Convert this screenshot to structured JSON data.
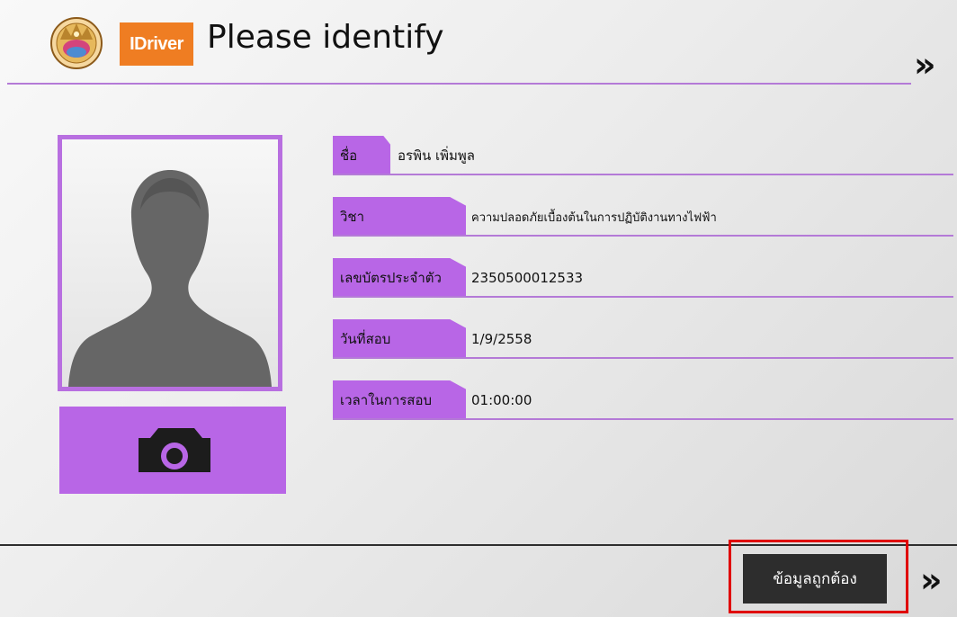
{
  "header": {
    "brand_logo_text": "IDriver",
    "title": "Please identify",
    "seal_icon": "government-seal-logo",
    "next_icon": "double-chevron-right-icon"
  },
  "profile": {
    "photo_icon": "person-silhouette-icon",
    "camera_icon": "camera-icon"
  },
  "fields": [
    {
      "label": "ชื่อ",
      "value": "อรพิน  เพิ่มพูล"
    },
    {
      "label": "วิชา",
      "value": "ความปลอดภัยเบื้องต้นในการปฏิบัติงานทางไฟฟ้า"
    },
    {
      "label": "เลขบัตรประจำตัว",
      "value": "2350500012533"
    },
    {
      "label": "วันที่สอบ",
      "value": "1/9/2558"
    },
    {
      "label": "เวลาในการสอบ",
      "value": "01:00:00"
    }
  ],
  "footer": {
    "confirm_label": "ข้อมูลถูกต้อง",
    "next_icon": "double-chevron-right-icon"
  },
  "colors": {
    "accent_purple": "#b866e6",
    "line_purple": "#b47ad7",
    "button_dark": "#2d2d2d",
    "highlight_red": "#e00000",
    "brand_orange": "#ef7d22"
  }
}
